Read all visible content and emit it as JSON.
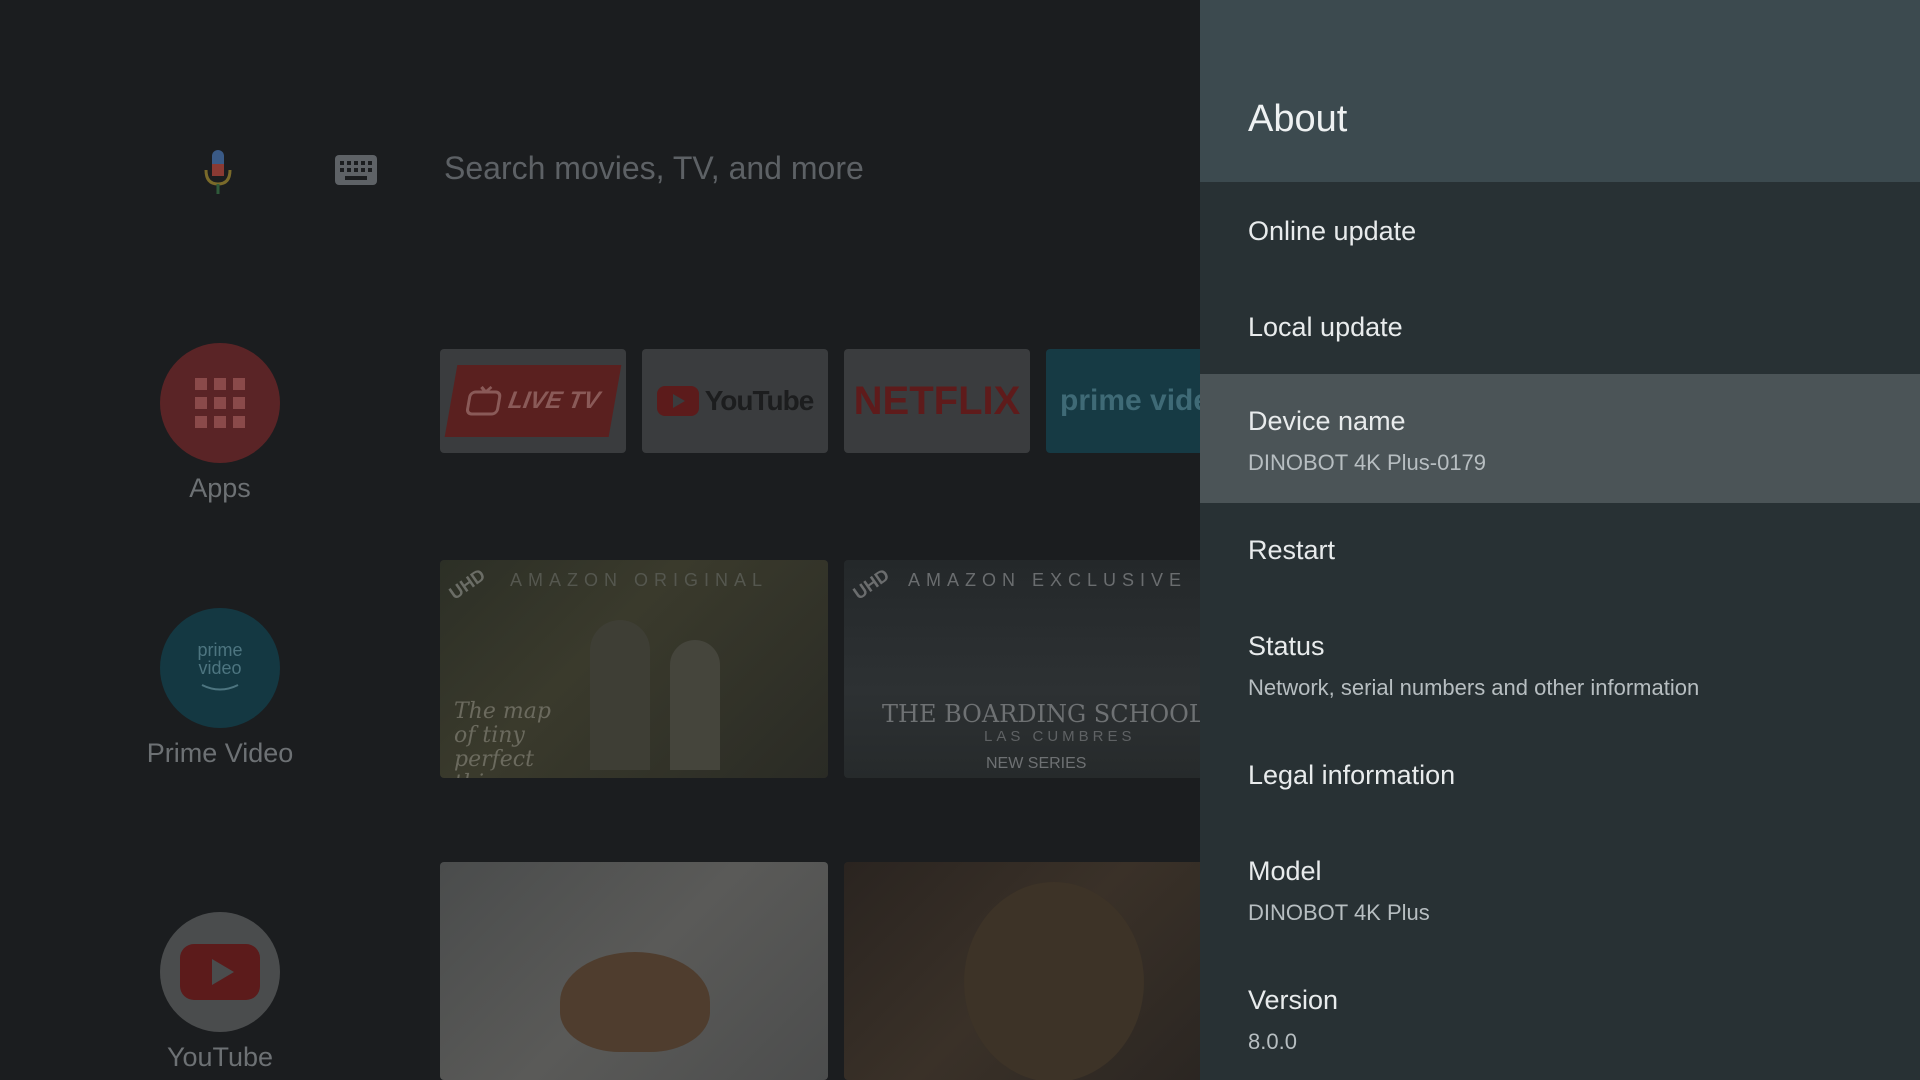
{
  "search": {
    "placeholder": "Search movies, TV, and more"
  },
  "left_apps": [
    {
      "label": "Apps",
      "icon": "grid-icon",
      "color": "#5a2426"
    },
    {
      "label": "Prime Video",
      "icon": "prime-video-icon",
      "logo_line1": "prime",
      "logo_line2": "video",
      "color": "#143842"
    },
    {
      "label": "YouTube",
      "icon": "youtube-play-icon",
      "color": "#4a4c4d"
    }
  ],
  "favorites": [
    {
      "name": "LIVE TV",
      "color": "#d23a36"
    },
    {
      "name": "YouTube",
      "color": "#6b6f71"
    },
    {
      "name": "NETFLIX",
      "color": "#6c7073"
    },
    {
      "name": "prime video",
      "color": "#16566a"
    }
  ],
  "cards": [
    {
      "badge": "UHD",
      "banner": "AMAZON ORIGINAL",
      "title": "The map of tiny perfect things"
    },
    {
      "badge": "UHD",
      "banner": "AMAZON EXCLUSIVE",
      "title": "THE BOARDING SCHOOL",
      "subtitle": "LAS CUMBRES",
      "tag": "NEW SERIES"
    }
  ],
  "panel": {
    "title": "About",
    "items": [
      {
        "title": "Online update"
      },
      {
        "title": "Local update"
      },
      {
        "title": "Device name",
        "subtitle": "DINOBOT 4K Plus-0179",
        "focused": true
      },
      {
        "title": "Restart"
      },
      {
        "title": "Status",
        "subtitle": "Network, serial numbers and other information"
      },
      {
        "title": "Legal information"
      },
      {
        "title": "Model",
        "subtitle": "DINOBOT 4K Plus"
      },
      {
        "title": "Version",
        "subtitle": "8.0.0"
      }
    ]
  },
  "colors": {
    "panel_bg": "#283134",
    "panel_header_bg": "#3c4a4f",
    "focused_item_bg": "#4b5457",
    "launcher_bg": "#1b1d1f"
  }
}
